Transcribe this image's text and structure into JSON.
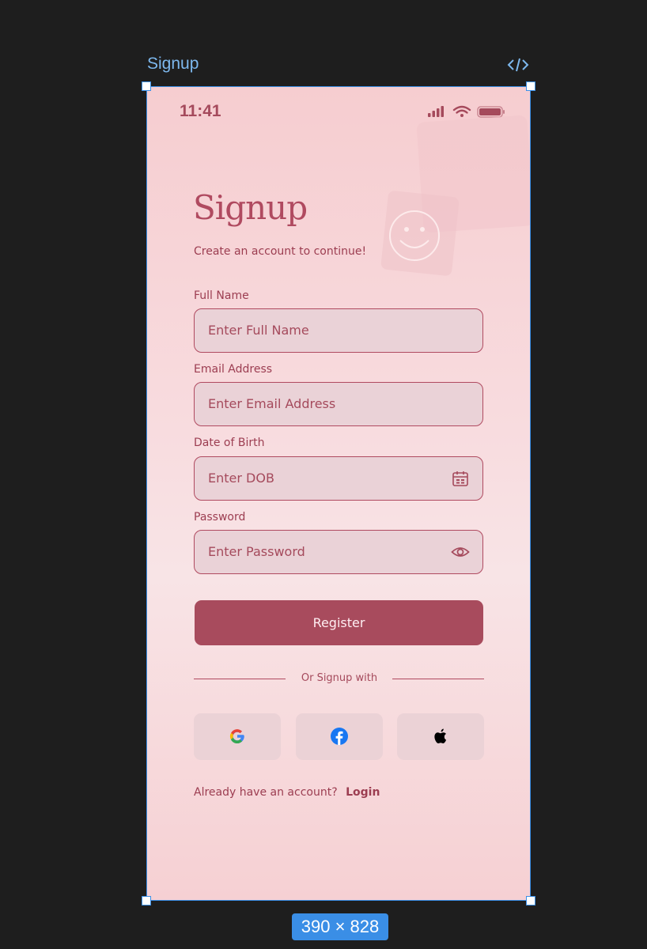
{
  "frame": {
    "title": "Signup",
    "size_label": "390 × 828"
  },
  "status_bar": {
    "time": "11:41"
  },
  "form": {
    "heading": "Signup",
    "subtitle": "Create an account to continue!",
    "fields": [
      {
        "label": "Full Name",
        "placeholder": "Enter Full Name"
      },
      {
        "label": "Email Address",
        "placeholder": "Enter Email Address"
      },
      {
        "label": "Date of Birth",
        "placeholder": "Enter DOB",
        "icon": "calendar-icon"
      },
      {
        "label": "Password",
        "placeholder": "Enter Password",
        "icon": "eye-icon"
      }
    ],
    "register_label": "Register",
    "divider_text": "Or Signup with",
    "social": [
      "google-icon",
      "facebook-icon",
      "apple-icon"
    ],
    "login_prompt": "Already have an account?",
    "login_label": "Login"
  },
  "colors": {
    "accent": "#a84b5d",
    "text": "#9c3d51",
    "field_bg": "#ead2d7",
    "selection": "#3a8ee6"
  }
}
